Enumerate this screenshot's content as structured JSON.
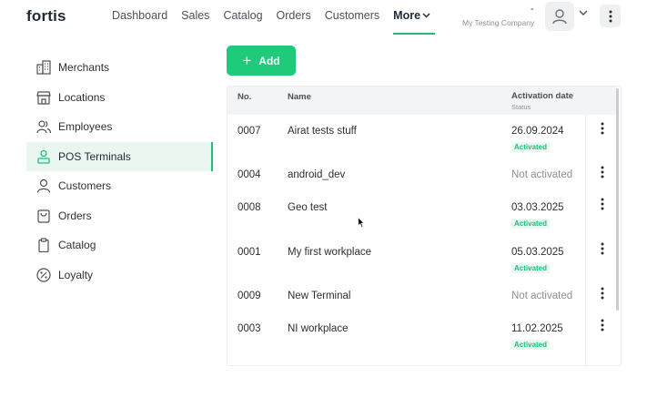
{
  "header": {
    "logo": "fortis",
    "nav": [
      "Dashboard",
      "Sales",
      "Catalog",
      "Orders",
      "Customers"
    ],
    "more_label": "More",
    "company_top": "-",
    "company_name": "My Testing Company"
  },
  "sidebar": {
    "items": [
      {
        "label": "Merchants",
        "icon": "building-icon"
      },
      {
        "label": "Locations",
        "icon": "store-icon"
      },
      {
        "label": "Employees",
        "icon": "users-icon"
      },
      {
        "label": "POS Terminals",
        "icon": "terminal-user-icon"
      },
      {
        "label": "Customers",
        "icon": "user-icon"
      },
      {
        "label": "Orders",
        "icon": "bag-icon"
      },
      {
        "label": "Catalog",
        "icon": "clipboard-icon"
      },
      {
        "label": "Loyalty",
        "icon": "percent-icon"
      }
    ],
    "active_index": 3
  },
  "toolbar": {
    "add_label": "Add"
  },
  "table": {
    "headers": {
      "no": "No.",
      "name": "Name",
      "activation": "Activation date",
      "status": "Status"
    },
    "rows": [
      {
        "no": "0007",
        "name": "Airat tests stuff",
        "date": "26.09.2024",
        "status": "Activated"
      },
      {
        "no": "0004",
        "name": "android_dev",
        "date": "Not activated",
        "status": ""
      },
      {
        "no": "0008",
        "name": "Geo test",
        "date": "03.03.2025",
        "status": "Activated"
      },
      {
        "no": "0001",
        "name": "My first workplace",
        "date": "05.03.2025",
        "status": "Activated"
      },
      {
        "no": "0009",
        "name": "New Terminal",
        "date": "Not activated",
        "status": ""
      },
      {
        "no": "0003",
        "name": "NI workplace",
        "date": "11.02.2025",
        "status": "Activated"
      }
    ]
  },
  "colors": {
    "accent": "#1fcb7a",
    "active_bg": "#eaf6f0",
    "muted": "#8a9097"
  }
}
